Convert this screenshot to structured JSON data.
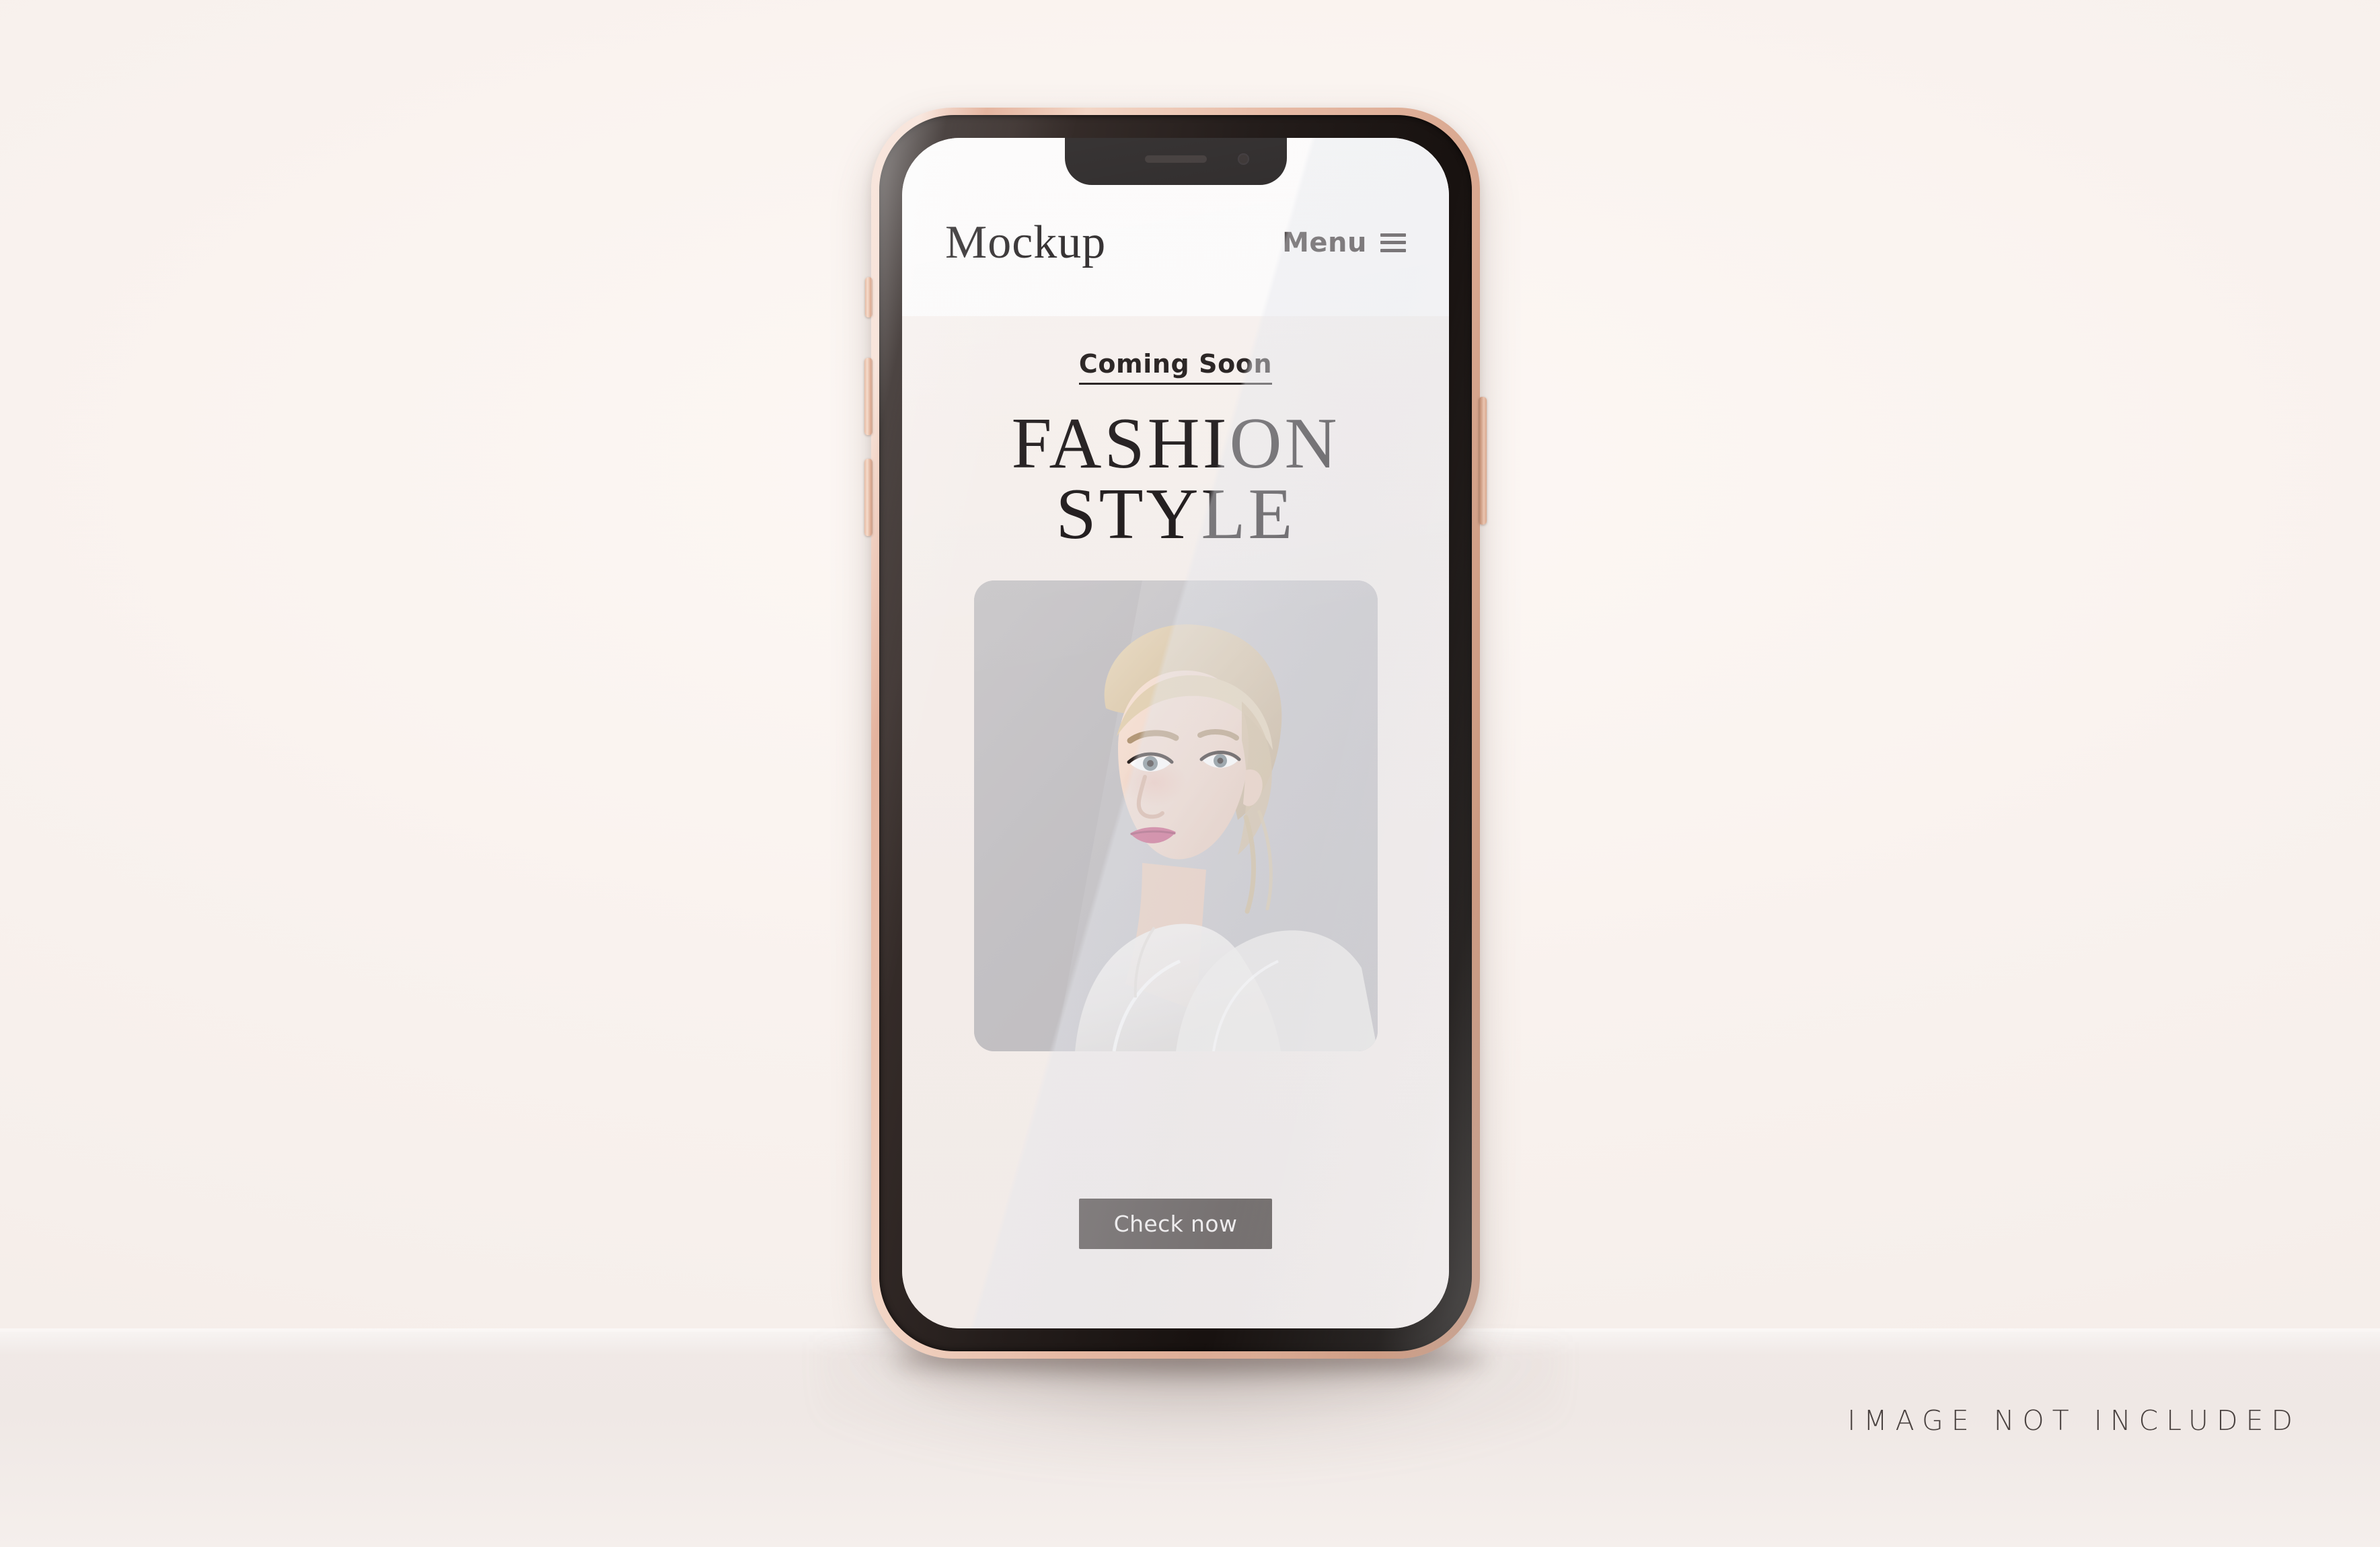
{
  "scene": {
    "background_color": "#faf4f0",
    "floor_color": "#f0e9e6",
    "watermark": "IMAGE NOT INCLUDED"
  },
  "device": {
    "type": "smartphone-mockup",
    "frame_color": "#e6b9a4",
    "bezel_color": "#17110f",
    "buttons": {
      "mute_switch": "Silent switch",
      "volume_up": "Volume up",
      "volume_down": "Volume down",
      "power": "Power / side button"
    },
    "notch": {
      "speaker": "earpiece-speaker",
      "camera": "front-camera"
    }
  },
  "screen": {
    "header": {
      "brand": "Mockup",
      "menu_label": "Menu",
      "menu_icon": "hamburger-icon",
      "background_color": "#fbfafa"
    },
    "hero": {
      "eyebrow": "Coming Soon",
      "headline_line1": "FASHION",
      "headline_line2": "STYLE",
      "background_color": "#f3ece9",
      "text_color": "#1a1516"
    },
    "photo": {
      "alt": "Fashion model portrait with blonde updo in sheer white blouse",
      "background_color": "#c9c7c9"
    },
    "cta": {
      "label": "Check now",
      "background_color": "#3a312d",
      "text_color": "#f6f2f0"
    }
  }
}
